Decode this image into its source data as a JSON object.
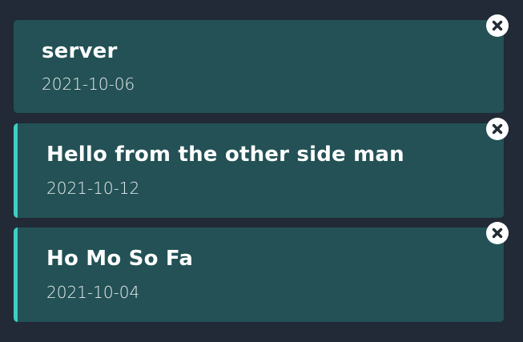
{
  "notes": [
    {
      "title": "server",
      "date": "2021-10-06",
      "reminder": false
    },
    {
      "title": "Hello from the other side man",
      "date": "2021-10-12",
      "reminder": true
    },
    {
      "title": "Ho Mo So Fa",
      "date": "2021-10-04",
      "reminder": true
    }
  ],
  "icons": {
    "close": "close-icon"
  },
  "colors": {
    "background": "#212a36",
    "card": "#235155",
    "accent": "#3ecfc4",
    "close_icon": "#222a36"
  }
}
